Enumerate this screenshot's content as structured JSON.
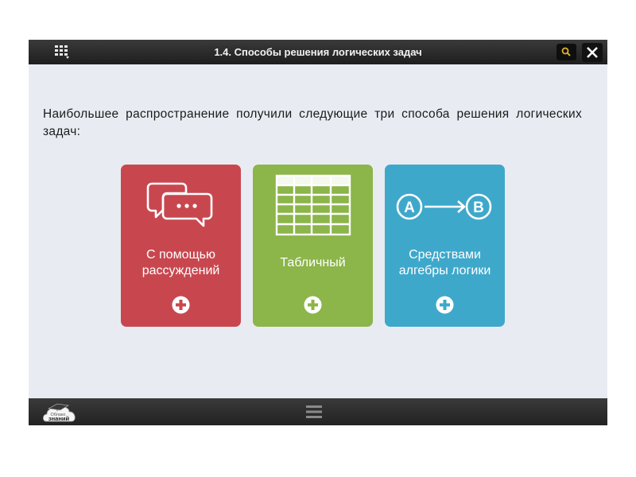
{
  "window": {
    "title": "1.4. Способы решения логических задач",
    "menu_icon": "grid-menu-icon",
    "search_icon": "magnifier-icon",
    "close_icon": "close-icon"
  },
  "content": {
    "intro": "Наибольшее распространение получили следующие три способа решения логических задач:"
  },
  "cards": [
    {
      "label_line1": "С помощью",
      "label_line2": "рассуждений",
      "icon": "speech-bubbles-icon",
      "color": "#c8474f"
    },
    {
      "label_line1": "Табличный",
      "label_line2": "",
      "icon": "table-icon",
      "color": "#8cb54a"
    },
    {
      "label_line1": "Средствами",
      "label_line2": "алгебры логики",
      "icon": "a-to-b-icon",
      "color": "#3ea8cb"
    }
  ],
  "footer": {
    "logo_line1": "Облако",
    "logo_line2": "знаний",
    "grip_icon": "hamburger-icon"
  }
}
